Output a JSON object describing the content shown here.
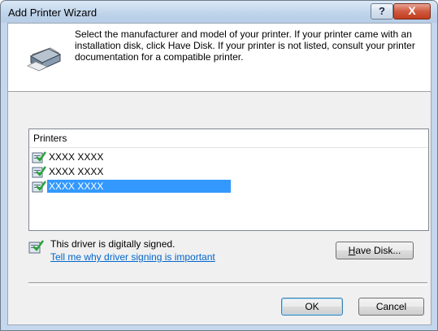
{
  "window": {
    "title": "Add Printer Wizard"
  },
  "titlebar_buttons": {
    "help": "?",
    "close": "X"
  },
  "header": {
    "instruction": "Select the manufacturer and model of your printer. If your printer came with an installation disk, click Have Disk. If your printer is not listed, consult your printer documentation for a compatible printer."
  },
  "printers": {
    "header": "Printers",
    "items": [
      {
        "label": "XXXX XXXX",
        "selected": false
      },
      {
        "label": "XXXX XXXX",
        "selected": false
      },
      {
        "label": "XXXX XXXX",
        "selected": true
      }
    ]
  },
  "signing": {
    "status": "This driver is digitally signed.",
    "link": "Tell me why driver signing is important"
  },
  "buttons": {
    "have_disk_prefix": "H",
    "have_disk_rest": "ave Disk...",
    "ok": "OK",
    "cancel": "Cancel"
  },
  "colors": {
    "selection": "#3399ff",
    "link": "#0066cc",
    "title_bar": "#bed3ea"
  }
}
